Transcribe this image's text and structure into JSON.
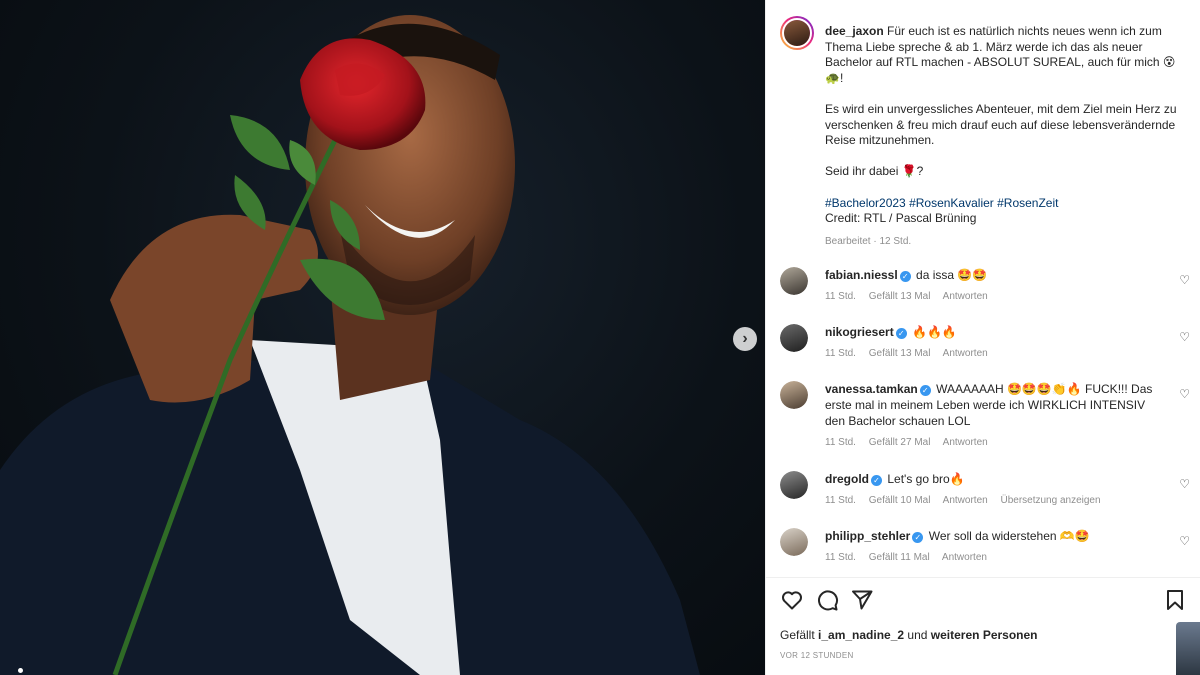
{
  "post": {
    "author": "dee_jaxon",
    "caption_lines": [
      "Für euch ist es natürlich nichts neues wenn ich zum Thema Liebe spreche & ab 1. März werde ich das als neuer Bachelor auf RTL machen - ABSOLUT SUREAL, auch für mich 😵🐢!",
      "Es wird ein unvergessliches Abenteuer, mit dem Ziel mein Herz zu verschenken & freu mich drauf euch auf diese lebensverändernde Reise mitzunehmen.",
      "Seid ihr dabei 🌹?"
    ],
    "hashtags": "#Bachelor2023 #RosenKavalier #RosenZeit",
    "credit": "Credit: RTL / Pascal Brüning",
    "edited": "Bearbeitet",
    "age": "12 Std."
  },
  "comments": [
    {
      "user": "fabian.niessl",
      "text": "da issa 🤩🤩",
      "age": "11 Std.",
      "likes": "Gefällt 13 Mal",
      "reply": "Antworten",
      "translate": "",
      "verified": true
    },
    {
      "user": "nikogriesert",
      "text": "🔥🔥🔥",
      "age": "11 Std.",
      "likes": "Gefällt 13 Mal",
      "reply": "Antworten",
      "translate": "",
      "verified": true
    },
    {
      "user": "vanessa.tamkan",
      "text": "WAAAAAAH 🤩🤩🤩👏🔥 FUCK!!! Das erste mal in meinem Leben werde ich WIRKLICH INTENSIV den Bachelor schauen LOL",
      "age": "11 Std.",
      "likes": "Gefällt 27 Mal",
      "reply": "Antworten",
      "translate": "",
      "verified": true
    },
    {
      "user": "dregold",
      "text": "Let's go bro🔥",
      "age": "11 Std.",
      "likes": "Gefällt 10 Mal",
      "reply": "Antworten",
      "translate": "Übersetzung anzeigen",
      "verified": true
    },
    {
      "user": "philipp_stehler",
      "text": "Wer soll da widerstehen 🫶🤩",
      "age": "11 Std.",
      "likes": "Gefällt 11 Mal",
      "reply": "Antworten",
      "translate": "",
      "verified": true
    }
  ],
  "footer": {
    "liked_prefix": "Gefällt",
    "liked_user": "i_am_nadine_2",
    "liked_middle": "und",
    "liked_others": "weiteren Personen",
    "timestamp": "VOR 12 STUNDEN"
  },
  "icons": {
    "like": "heart-icon",
    "comment": "comment-icon",
    "share": "share-icon",
    "save": "bookmark-icon",
    "next": "chevron-right-icon",
    "verified": "verified-badge-icon"
  },
  "colors": {
    "verified": "#3897f0",
    "hashtag": "#00376b",
    "muted": "#8e8e8e",
    "text": "#262626"
  }
}
